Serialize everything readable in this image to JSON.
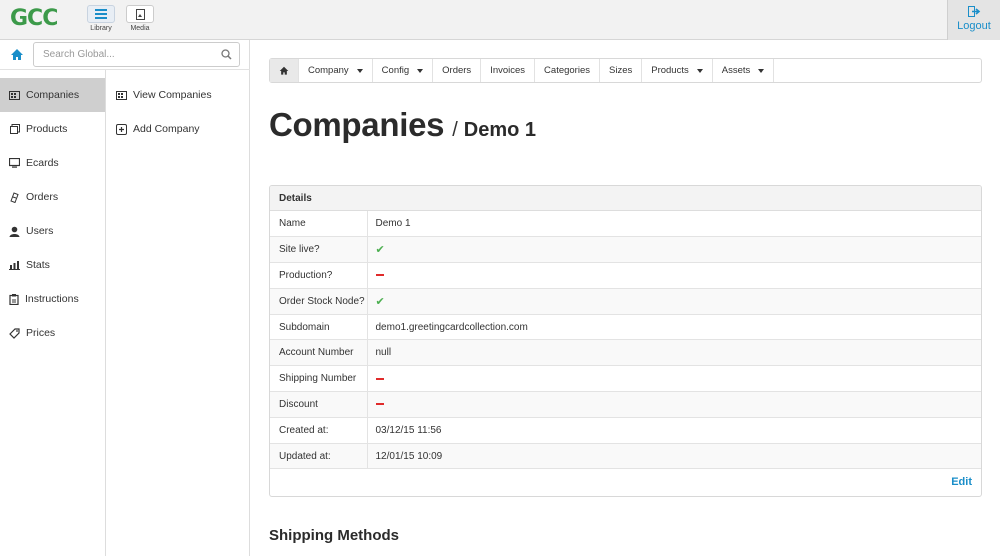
{
  "topbar": {
    "logo": "GCC",
    "tools": [
      {
        "label": "Library",
        "icon": "list-icon"
      },
      {
        "label": "Media",
        "icon": "image-icon"
      }
    ],
    "logout_label": "Logout"
  },
  "search": {
    "placeholder": "Search Global..."
  },
  "sidebar": {
    "items": [
      {
        "label": "Companies",
        "icon": "building-icon"
      },
      {
        "label": "Products",
        "icon": "tag-icon"
      },
      {
        "label": "Ecards",
        "icon": "monitor-icon"
      },
      {
        "label": "Orders",
        "icon": "clipboard-icon"
      },
      {
        "label": "Users",
        "icon": "user-icon"
      },
      {
        "label": "Stats",
        "icon": "bar-chart-icon"
      },
      {
        "label": "Instructions",
        "icon": "document-icon"
      },
      {
        "label": "Prices",
        "icon": "price-tag-icon"
      }
    ],
    "active": "Companies"
  },
  "subnav": {
    "items": [
      {
        "label": "View Companies",
        "icon": "building-icon"
      },
      {
        "label": "Add Company",
        "icon": "plus-square-icon"
      }
    ]
  },
  "tabs": [
    {
      "label": "Company",
      "dropdown": true
    },
    {
      "label": "Config",
      "dropdown": true
    },
    {
      "label": "Orders",
      "dropdown": false
    },
    {
      "label": "Invoices",
      "dropdown": false
    },
    {
      "label": "Categories",
      "dropdown": false
    },
    {
      "label": "Sizes",
      "dropdown": false
    },
    {
      "label": "Products",
      "dropdown": true
    },
    {
      "label": "Assets",
      "dropdown": true
    }
  ],
  "page": {
    "title": "Companies",
    "separator": "/",
    "subtitle": "Demo 1"
  },
  "details": {
    "heading": "Details",
    "rows": [
      {
        "key": "Name",
        "value": "Demo 1"
      },
      {
        "key": "Site live?",
        "value": "✔"
      },
      {
        "key": "Production?",
        "value": ""
      },
      {
        "key": "Order Stock Node?",
        "value": "✔"
      },
      {
        "key": "Subdomain",
        "value": "demo1.greetingcardcollection.com"
      },
      {
        "key": "Account Number",
        "value": "null"
      },
      {
        "key": "Shipping Number",
        "value": ""
      },
      {
        "key": "Discount",
        "value": ""
      },
      {
        "key": "Created at:",
        "value": "03/12/15 11:56"
      },
      {
        "key": "Updated at:",
        "value": "12/01/15 10:09"
      }
    ],
    "edit_label": "Edit"
  },
  "section_title": "Shipping Methods",
  "colors": {
    "accent": "#1a8ec9",
    "check": "#4caf50",
    "dash": "#e02b2b",
    "logo": "#3c9a4a"
  }
}
